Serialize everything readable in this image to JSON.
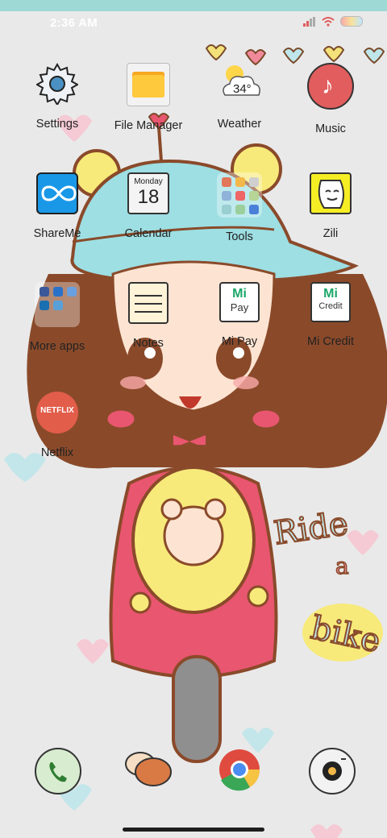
{
  "status_bar": {
    "time": "2:36 AM"
  },
  "apps": [
    {
      "label": "Settings",
      "icon": "settings-icon"
    },
    {
      "label": "File Manager",
      "icon": "folder-icon"
    },
    {
      "label": "Weather",
      "icon": "weather-icon",
      "temp": "34°"
    },
    {
      "label": "Music",
      "icon": "music-icon"
    },
    {
      "label": "ShareMe",
      "icon": "shareme-icon"
    },
    {
      "label": "Calendar",
      "icon": "calendar-icon",
      "day": "Monday",
      "date": "18"
    },
    {
      "label": "Tools",
      "icon": "tools-folder-icon"
    },
    {
      "label": "Zili",
      "icon": "zili-icon"
    },
    {
      "label": "More apps",
      "icon": "more-apps-folder-icon"
    },
    {
      "label": "Notes",
      "icon": "notes-icon"
    },
    {
      "label": "Mi Pay",
      "icon": "mi-pay-icon",
      "badge": "Pay"
    },
    {
      "label": "Mi Credit",
      "icon": "mi-credit-icon",
      "badge": "Credit"
    },
    {
      "label": "Netflix",
      "icon": "netflix-icon",
      "badge": "NETFLIX"
    }
  ],
  "dock": [
    "phone-icon",
    "messages-icon",
    "chrome-icon",
    "camera-icon"
  ],
  "wallpaper": {
    "text1": "Ride",
    "text2": "a",
    "text3": "bike"
  },
  "colors": {
    "status_accent": "#9fd9d6",
    "hat": "#9ddfe3",
    "scooter": "#e9566f",
    "yellow": "#f7ea7a",
    "hair": "#8a4a2a"
  }
}
